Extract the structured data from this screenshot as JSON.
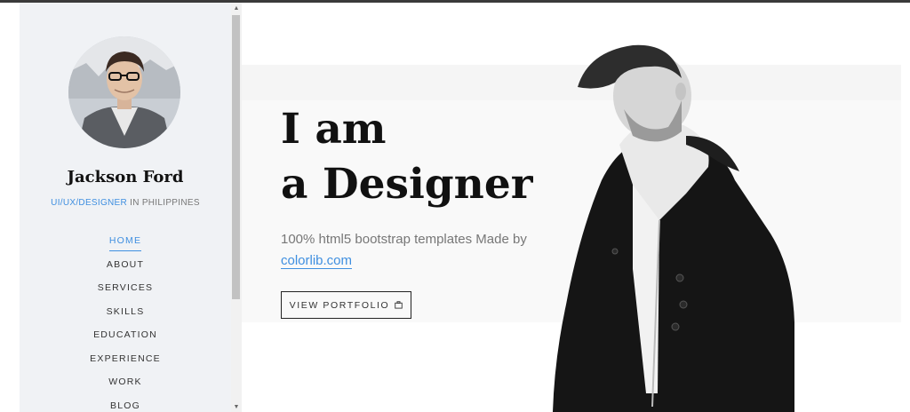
{
  "profile": {
    "name": "Jackson Ford",
    "role_highlight": "UI/UX/DESIGNER",
    "role_rest": " IN PHILIPPINES"
  },
  "nav": {
    "items": [
      {
        "label": "HOME",
        "active": true
      },
      {
        "label": "ABOUT"
      },
      {
        "label": "SERVICES"
      },
      {
        "label": "SKILLS"
      },
      {
        "label": "EDUCATION"
      },
      {
        "label": "EXPERIENCE"
      },
      {
        "label": "WORK"
      },
      {
        "label": "BLOG"
      }
    ]
  },
  "hero": {
    "headline_line1": "I am",
    "headline_line2": "a Designer",
    "subtext_prefix": "100% html5 bootstrap templates Made by ",
    "subtext_link": "colorlib.com",
    "cta_label": "VIEW PORTFOLIO",
    "cta_icon": "briefcase-icon"
  },
  "colors": {
    "accent": "#3f8fe0",
    "sidebar_bg": "#f0f2f5",
    "text_dark": "#111111"
  }
}
